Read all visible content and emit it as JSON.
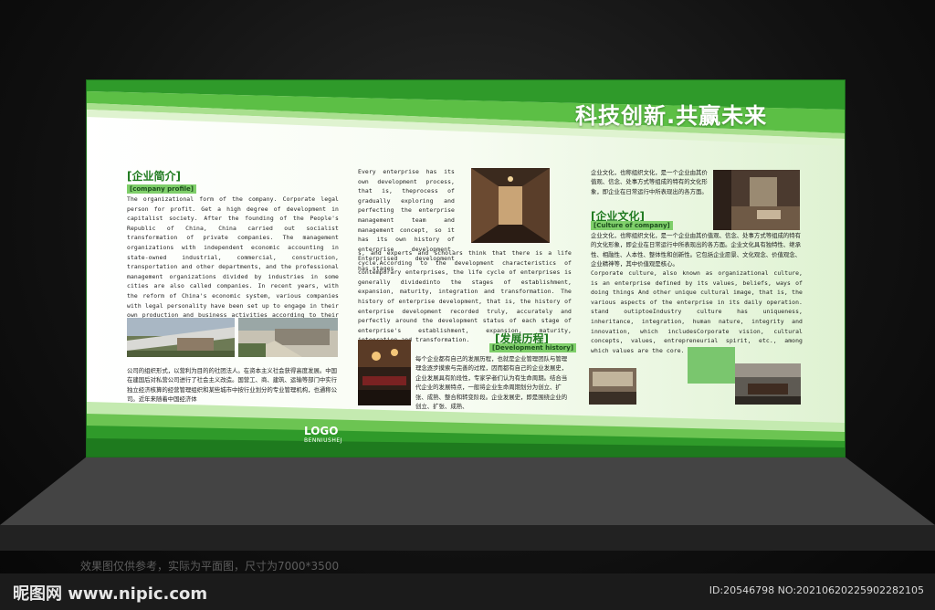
{
  "headline": "科技创新.共赢未来",
  "logo": {
    "main": "LOGO",
    "sub": "BENNIUSHEJ"
  },
  "intro": {
    "title": "[企业简介]",
    "subtitle": "[company profile]",
    "en_text": "The organizational form of the company. Corporate legal person for profit. Get a high degree of development in capitalist society. After the founding of the People's Republic of China, China carried out socialist transformation of private companies. The management organizations with independent economic accounting in state-owned industrial, commercial, construction, transportation and other departments, and the professional management organizations divided by industries in some cities are also called companies. In recent years, with the reform of China's economic system, various companies with legal personality have been set up to engage in their own production and business activities according to their articles of association.",
    "cn_text": "公司的组织形式，以营利为目的的社团法人。在资本主义社会获得高度发展。中国在建国后对私营公司进行了社会主义改造。国营工、商、建筑、运输等部门中实行独立经济核算的经营管理组织和某些城市中按行业划分的专业管理机构，也通称公司。近年来随着中国经济体"
  },
  "development": {
    "en_text_top": "Every enterprise has its own development process, that is, theprocess of gradually exploring and perfecting the enterprise management team and management concept, so it has its own history of enterprise development. Enterprised development has stages",
    "en_text_bottom": "s, and experts and scholars think that there is a life cycle.According to the development characteristics of contemporary enterprises, the life cycle of enterprises is generally dividedinto the stages of establishment, expansion, maturity, integration and transformation. The history of enterprise development, that is, the history of enterprise development recorded truly, accurately and perfectly around the development status of each stage of enterprise's establishment, expansion, maturity, integration and transformation.",
    "title": "[发展历程]",
    "subtitle": "[Development history]",
    "cn_text": "每个企业都有自己的发展历程，也就是企业管理团队与管理理念逐步摸索与完善的过程，因而都有自己的企业发展史，企业发展具有阶段性，专家学者们认为有生命周期。结合当代企业的发展特点，一般将企业生命周期划分为创立、扩张、成熟、整合和转变阶段。企业发展史，即是围绕企业的创立、扩张、成熟、"
  },
  "culture": {
    "cn_text_top": "企业文化，也称组织文化，是一个企业由其价值观、信念、处事方式等组成的特有的文化形象，即企业在日常运行中所表现出的各方面。",
    "title": "[企业文化]",
    "subtitle": "[Culture of company]",
    "cn_text_mid": "企业文化，也称组织文化，是一个企业由其价值观、信念、处事方式等组成的特有的文化形象，即企业在日常运行中所表现出的各方面。企业文化具有独特性、继承性、相融性、人本性、整体性和创新性。它包括企业愿景、文化观念、价值观念、企业精神等，其中价值观是核心。",
    "en_text": "Corporate culture, also known as organizational culture, is an enterprise defined by its values, beliefs, ways of doing things And other unique cultural image, that is, the various aspects of the enterprise in its daily operation. stand outiptoeIndustry culture has uniqueness, inheritance, integration, human nature, integrity and innovation, which includesCorporate vision, cultural concepts, values, entrepreneurial spirit, etc., among which values are the core."
  },
  "disclaimer": "效果图仅供参考，实际为平面图，尺寸为7000*3500",
  "watermark": {
    "logo": "昵图网 www.nipic.com",
    "id": "ID:20546798 NO:20210620225902282105"
  },
  "colors": {
    "green_dark": "#1f8a1f",
    "green_mid": "#4cb33a",
    "green_light": "#c8ecb6",
    "panel_bg": "#eaf7e0"
  }
}
